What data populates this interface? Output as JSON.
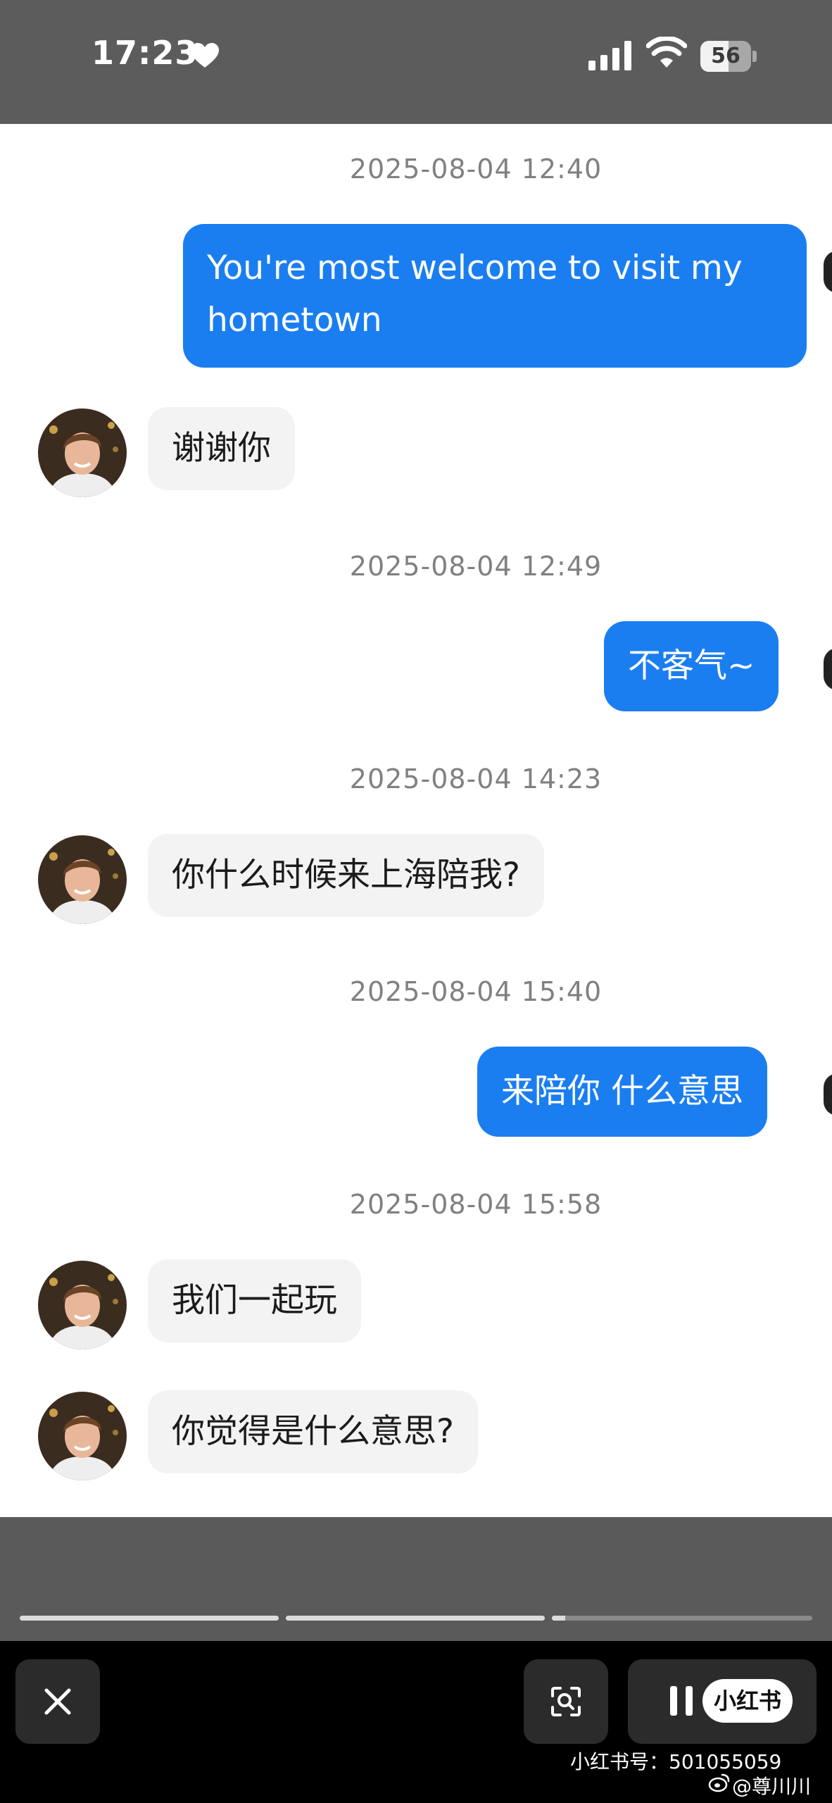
{
  "status_bar": {
    "time": "17:23",
    "battery_level": "56",
    "battery_fraction": 0.56
  },
  "messages": [
    {
      "timestamp": "2025-08-04 12:40"
    },
    {
      "sender": "me",
      "lines": [
        "You're most welcome to visit my",
        "hometown"
      ]
    },
    {
      "sender": "them",
      "text": "谢谢你"
    },
    {
      "timestamp": "2025-08-04 12:49"
    },
    {
      "sender": "me",
      "text": "不客气~"
    },
    {
      "timestamp": "2025-08-04 14:23"
    },
    {
      "sender": "them",
      "text": "你什么时候来上海陪我?"
    },
    {
      "timestamp": "2025-08-04 15:40"
    },
    {
      "sender": "me",
      "text": "来陪你 什么意思"
    },
    {
      "timestamp": "2025-08-04 15:58"
    },
    {
      "sender": "them",
      "text": "我们一起玩"
    },
    {
      "sender": "them",
      "text": "你觉得是什么意思?"
    }
  ],
  "player": {
    "progress_segments": 3,
    "active_segment_fill": 0.05
  },
  "watermark": {
    "brand": "小红书",
    "id_line": "小红书号：501055059",
    "handle": "@尊川川"
  }
}
